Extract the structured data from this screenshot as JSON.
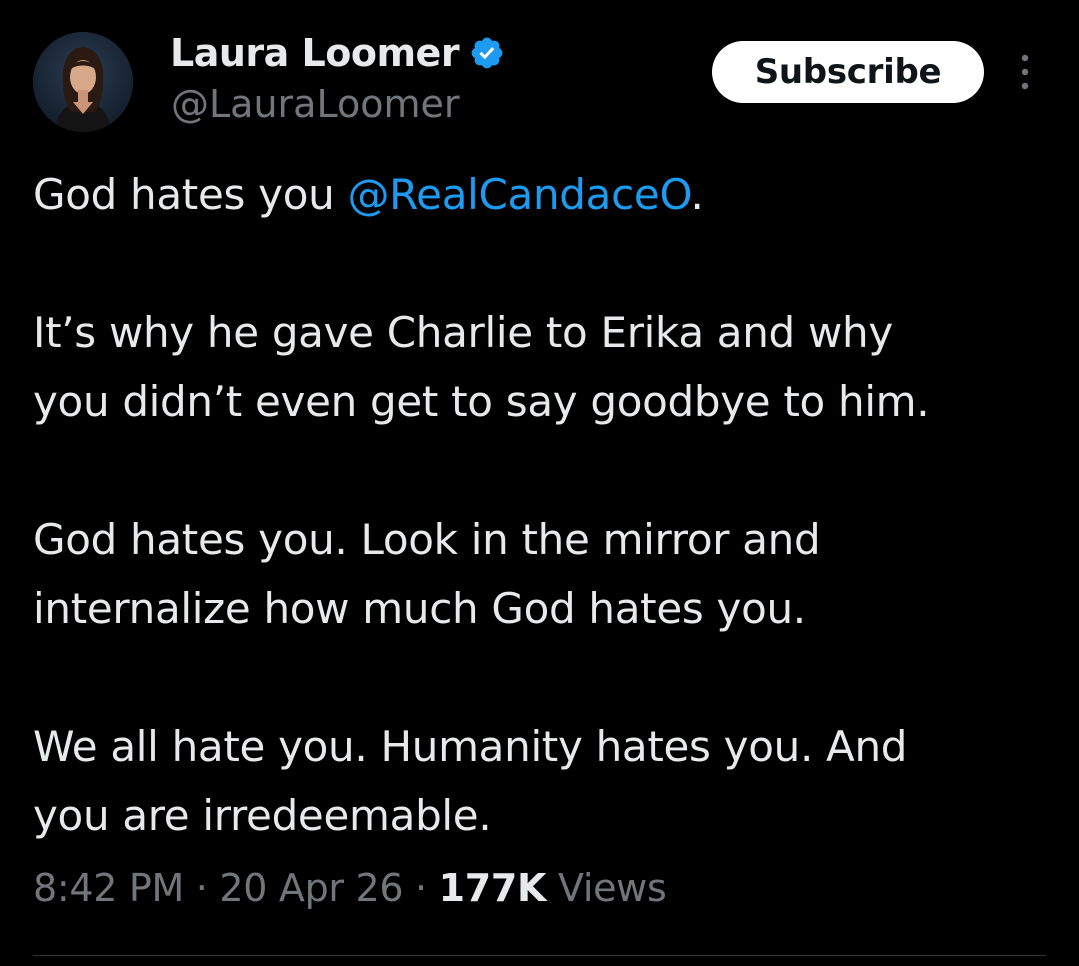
{
  "author": {
    "display_name": "Laura Loomer",
    "handle": "@LauraLoomer",
    "verified_icon": "verified-badge-icon",
    "avatar_icon": "profile-photo"
  },
  "actions": {
    "subscribe_label": "Subscribe",
    "more_icon": "more-vertical-icon"
  },
  "tweet": {
    "line_1_prefix": "God hates you ",
    "line_1_mention": "@RealCandaceO",
    "line_1_suffix": ".",
    "para_2_line_1": "It’s why he gave Charlie to Erika and why",
    "para_2_line_2": "you didn’t even get to say goodbye to him.",
    "para_3_line_1": "God hates you. Look in the mirror and",
    "para_3_line_2": "internalize how much God hates you.",
    "para_4_line_1": "We all hate you. Humanity hates you. And",
    "para_4_line_2": "you are irredeemable."
  },
  "meta": {
    "time": "8:42 PM",
    "separator_1": " · ",
    "date": "20 Apr 26",
    "separator_2": " · ",
    "views_count": "177K",
    "views_label": " Views"
  },
  "colors": {
    "background": "#000000",
    "text": "#e7e9ea",
    "secondary": "#71767b",
    "link": "#1d9bf0"
  }
}
